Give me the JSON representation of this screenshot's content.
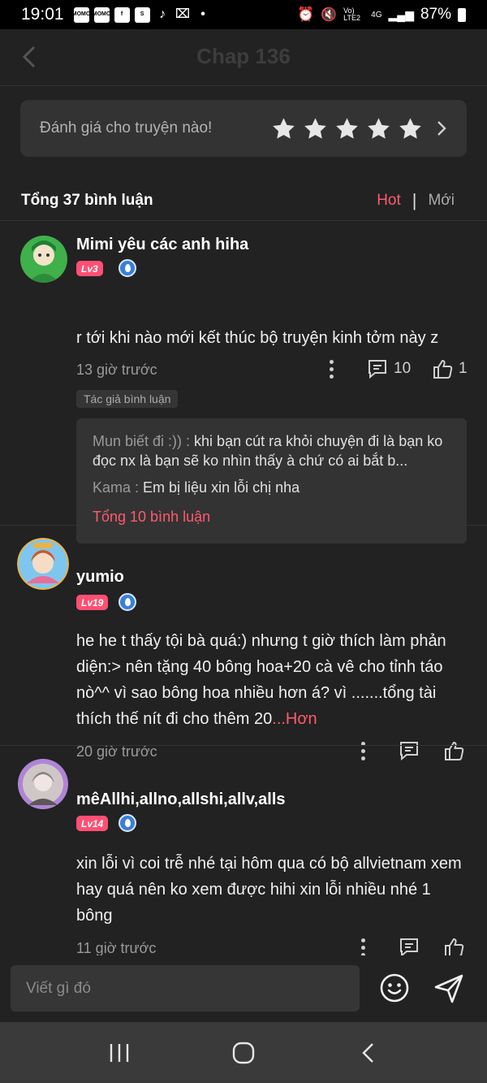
{
  "status_bar": {
    "time": "19:01",
    "left_icons": [
      "MOMO",
      "MOMO",
      "f",
      "S",
      "tiktok-icon",
      "capcut-icon",
      "•"
    ],
    "network": "Vo) LTE2",
    "network_type": "4G",
    "battery": "87%"
  },
  "header": {
    "title": "Chap 136",
    "back_icon": "chevron-left-icon"
  },
  "rating": {
    "prompt": "Đánh giá cho truyện nào!",
    "stars": 5,
    "star_color": "#e6e6e6"
  },
  "comments_header": {
    "total": "Tổng 37 bình luận",
    "tab_hot": "Hot",
    "separator": "|",
    "tab_new": "Mới"
  },
  "colors": {
    "accent": "#ff5a6e",
    "level_badge": "#ff4f73",
    "background": "#222222",
    "card": "#333333"
  },
  "comments": [
    {
      "username": "Mimi yêu các anh hiha",
      "level": "Lv3",
      "text": "r tới khi nào mới kết thúc bộ truyện kinh tởm này z",
      "time": "13 giờ trước",
      "reply_count": "10",
      "like_count": "1",
      "author_tag": "Tác giả bình luận",
      "replies": [
        {
          "who": "Mun biết đi :)) : ",
          "text": "khi bạn cút ra khỏi chuyện đi là bạn ko đọc nx là bạn sẽ ko nhìn thấy à chứ có ai bắt b..."
        },
        {
          "who": "Kama : ",
          "text": "Em bị liệu xin lỗi chị nha"
        }
      ],
      "replies_total": "Tổng 10 bình luận"
    },
    {
      "username": "yumio",
      "level": "Lv19",
      "text": "he he t thấy tội bà quá:) nhưng t giờ thích làm phản diện:> nên tặng 40 bông hoa+20 cà vê cho tỉnh táo nò^^ vì sao bông hoa nhiều hơn á? vì .......tổng tài thích thế nít đi cho thêm 20",
      "more": "...Hơn",
      "time": "20 giờ trước"
    },
    {
      "username": "mêAllhi,allno,allshi,allv,alls",
      "level": "Lv14",
      "text": "xin lỗi vì coi trễ nhé tại hôm qua có bộ allvietnam xem hay quá nên ko xem được hihi xin lỗi nhiều nhé 1 bông",
      "time": "11 giờ trước"
    }
  ],
  "composer": {
    "placeholder": "Viết gì đó",
    "emoji_icon": "smiley-icon",
    "send_icon": "send-icon"
  },
  "nav": {
    "recents_icon": "recents-icon",
    "home_icon": "home-icon",
    "back_icon": "back-icon"
  }
}
